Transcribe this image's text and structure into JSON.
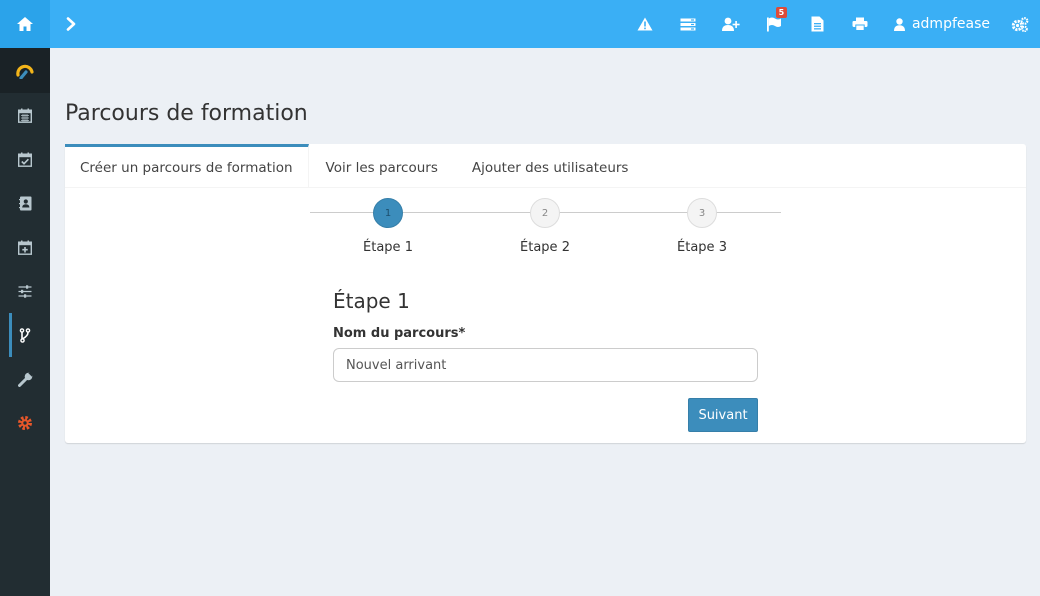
{
  "navbar": {
    "alerts_badge": "5",
    "username": "admpfease"
  },
  "page": {
    "title": "Parcours de formation"
  },
  "tabs": [
    {
      "label": "Créer un parcours de formation"
    },
    {
      "label": "Voir les parcours"
    },
    {
      "label": "Ajouter des utilisateurs"
    }
  ],
  "stepper": {
    "steps": [
      {
        "number": "1",
        "label": "Étape 1"
      },
      {
        "number": "2",
        "label": "Étape 2"
      },
      {
        "number": "3",
        "label": "Étape 3"
      }
    ],
    "current_step": 1
  },
  "form": {
    "heading": "Étape 1",
    "name_label": "Nom du parcours*",
    "name_value": "Nouvel arrivant",
    "next_label": "Suivant"
  },
  "colors": {
    "navbar": "#3aaff5",
    "sidebar": "#222d32",
    "primary": "#3c8dbc",
    "settings_accent": "#e8572a"
  },
  "icons": {
    "navbar": [
      "home-icon",
      "chevron-right-icon",
      "warning-icon",
      "server-icon",
      "user-plus-icon",
      "flag-icon",
      "file-text-icon",
      "print-icon",
      "user-icon",
      "cogs-icon"
    ],
    "sidebar": [
      "dashboard-logo-icon",
      "calendar-icon",
      "calendar-check-icon",
      "address-book-icon",
      "calendar-plus-icon",
      "sliders-icon",
      "code-fork-icon",
      "wrench-icon",
      "gear-icon"
    ]
  }
}
